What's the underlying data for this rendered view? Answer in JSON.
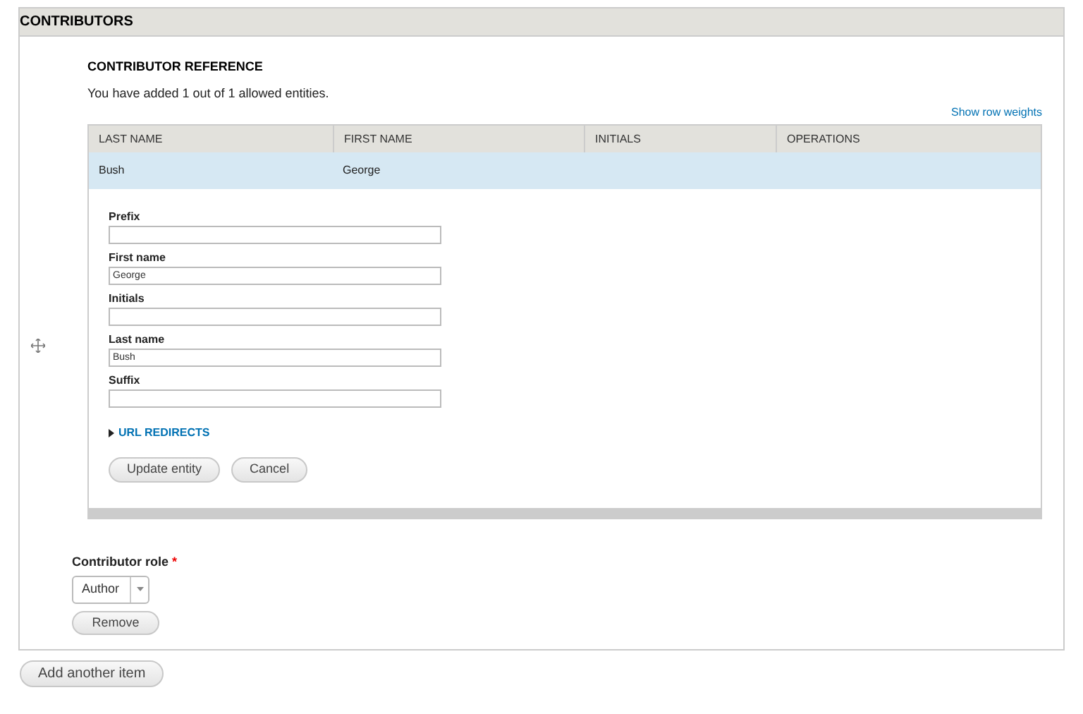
{
  "section": {
    "title": "CONTRIBUTORS"
  },
  "reference": {
    "title": "CONTRIBUTOR REFERENCE",
    "summary": "You have added 1 out of 1 allowed entities.",
    "row_weights_link": "Show row weights"
  },
  "table": {
    "columns": [
      "LAST NAME",
      "FIRST NAME",
      "INITIALS",
      "OPERATIONS"
    ],
    "rows": [
      {
        "cells": [
          "Bush",
          "George"
        ],
        "selected": true
      }
    ]
  },
  "form": {
    "fields": [
      {
        "label": "Prefix"
      },
      {
        "label": "First name",
        "value": "George"
      },
      {
        "label": "Initials"
      },
      {
        "label": "Last name",
        "value": "Bush"
      },
      {
        "label": "Suffix"
      }
    ],
    "details": {
      "label": "URL REDIRECTS",
      "expanded": false
    },
    "buttons": [
      "Update entity",
      "Cancel"
    ]
  },
  "role": {
    "label": "Contributor role",
    "required_mark": "*",
    "value": "Author"
  },
  "remove_button": "Remove",
  "add_button": "Add another item"
}
